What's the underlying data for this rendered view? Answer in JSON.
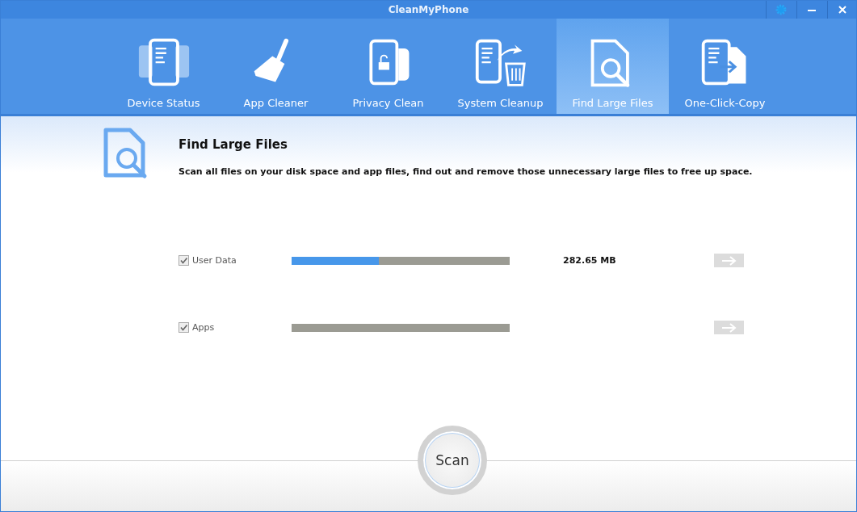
{
  "window": {
    "title": "CleanMyPhone"
  },
  "tabs": [
    {
      "label": "Device Status",
      "selected": false
    },
    {
      "label": "App Cleaner",
      "selected": false
    },
    {
      "label": "Privacy Clean",
      "selected": false
    },
    {
      "label": "System Cleanup",
      "selected": false
    },
    {
      "label": "Find Large Files",
      "selected": true
    },
    {
      "label": "One-Click-Copy",
      "selected": false
    }
  ],
  "header": {
    "title": "Find Large Files",
    "description": "Scan all files on your disk space and app files, find out and remove those unnecessary large files to free up space."
  },
  "categories": [
    {
      "label": "User Data",
      "checked": true,
      "level": 0.4,
      "size": "282.65 MB"
    },
    {
      "label": "Apps",
      "checked": true,
      "level": 0
    }
  ],
  "scan_button": "Scan"
}
